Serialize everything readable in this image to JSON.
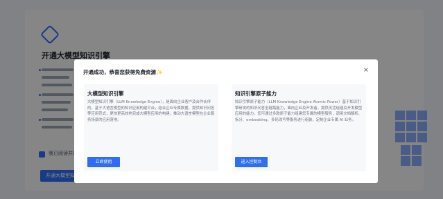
{
  "background": {
    "title": "开通大模型知识引擎",
    "checkbox_label": "我已阅读并同意",
    "button_label": "开通大模型知识引擎"
  },
  "dialog": {
    "title": "开通成功，恭喜您获得免费资源✨",
    "close_glyph": "×",
    "cards": [
      {
        "title": "大模型知识引擎",
        "description": "大模型知识引擎（LLM Knowledge Engine），是面向企业客户及合作伙伴的，基于大语言模型的知识应用构建平台，结合企业专属数据，提供知识问答等应用范式，更快更高效地完成大模型应用的构建，推动大语言模型在企业服务场景的应用落地。",
        "button_label": "立即使用"
      },
      {
        "title": "知识引擎原子能力",
        "description": "知识引擎原子能力（LLM Knowledge Engine Atomic Power）基于知识引擎研发的知识问答全链路能力，面向企业及开发者，提供灵活组建及开发模型应用的能力。您可通过多款原子能力组建您专属的模型服务，调用文档解析、拆分、embedding、多轮改写等服务进行组装，定制企业专属 AI 业务。",
        "button_label": "进入控制台"
      }
    ]
  },
  "colors": {
    "accent": "#2f6ef2",
    "overlay": "rgba(0,0,0,0.46)"
  }
}
